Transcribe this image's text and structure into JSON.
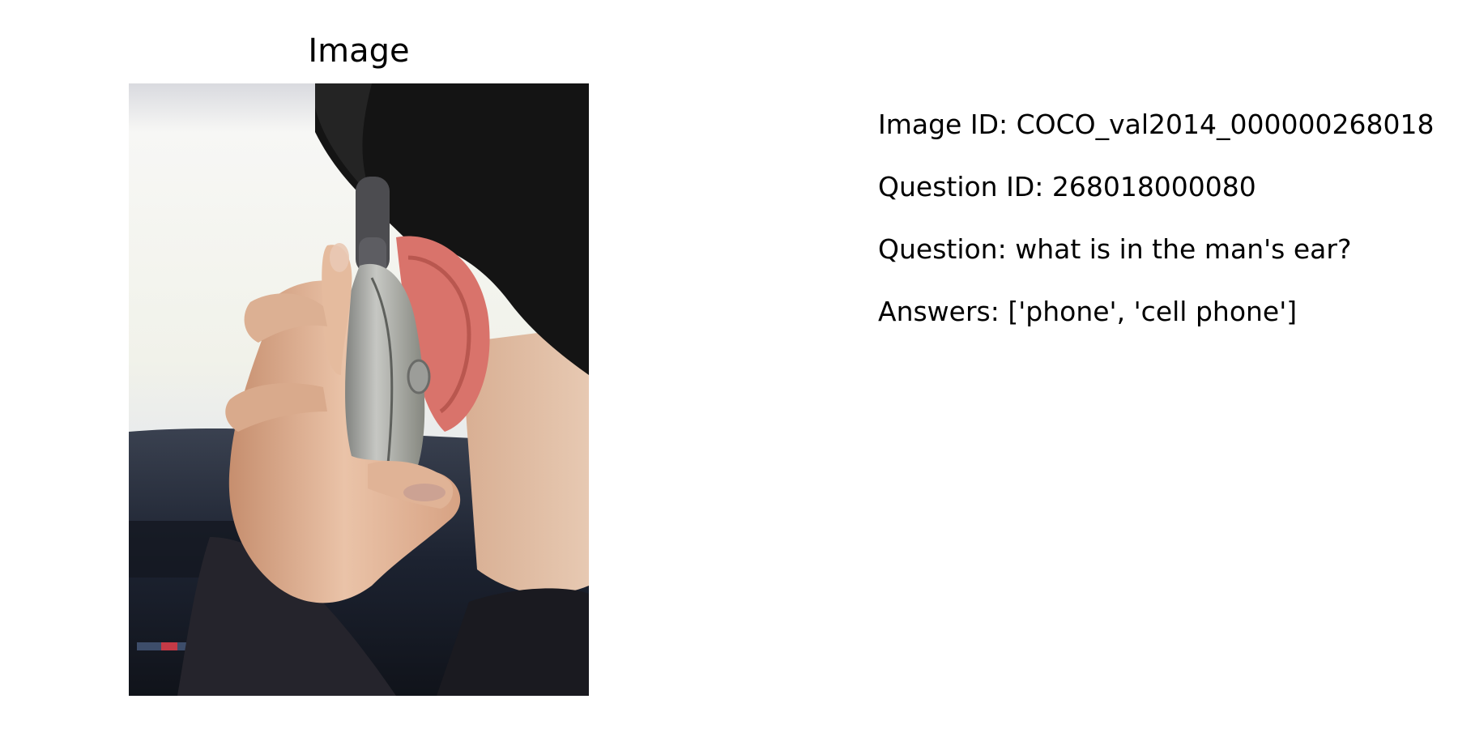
{
  "figure": {
    "title": "Image"
  },
  "info": {
    "image_id": "Image ID: COCO_val2014_000000268018",
    "question_id": "Question ID: 268018000080",
    "question": "Question: what is in the man's ear?",
    "answers": "Answers: ['phone', 'cell phone']"
  },
  "photo": {
    "subject": "hand-holding-phone-photo",
    "colors": {
      "hair": "#141414",
      "skin": "#e2b79a",
      "ear": "#d9736b",
      "phone": "#a9aaa6",
      "car_interior": "#1b1f2b",
      "window": "#f4f5f2"
    }
  }
}
